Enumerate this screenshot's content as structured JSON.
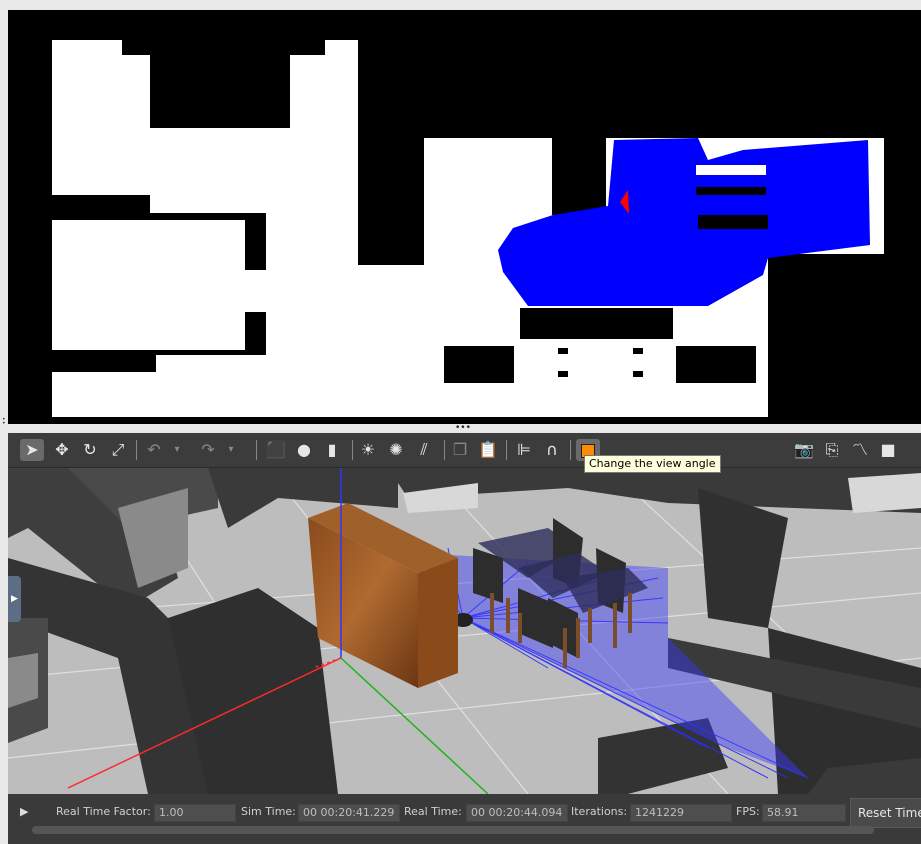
{
  "toolbar": {
    "tools": [
      "select-mode",
      "translate-mode",
      "rotate-mode",
      "scale-mode",
      "undo",
      "redo",
      "box-shape",
      "sphere-shape",
      "cylinder-shape",
      "point-light",
      "spot-light",
      "directional-light",
      "copy",
      "paste",
      "align",
      "snap",
      "change-view-angle"
    ],
    "right_tools": [
      "screenshot",
      "log-data",
      "plot",
      "record-video"
    ],
    "tooltip": "Change the view angle"
  },
  "status": {
    "rtf_label": "Real Time Factor:",
    "rtf_value": "1.00",
    "sim_label": "Sim Time:",
    "sim_value": "00 00:20:41.229",
    "real_label": "Real Time:",
    "real_value": "00 00:20:44.094",
    "iter_label": "Iterations:",
    "iter_value": "1241229",
    "fps_label": "FPS:",
    "fps_value": "58.91",
    "reset_label": "Reset Time"
  },
  "colors": {
    "laser": "#0000ff",
    "robot_marker": "#ff0000",
    "toolbar_bg": "#3c3c3c",
    "tooltip_bg": "#ffffdc",
    "active_tool": "#ff8c00"
  }
}
